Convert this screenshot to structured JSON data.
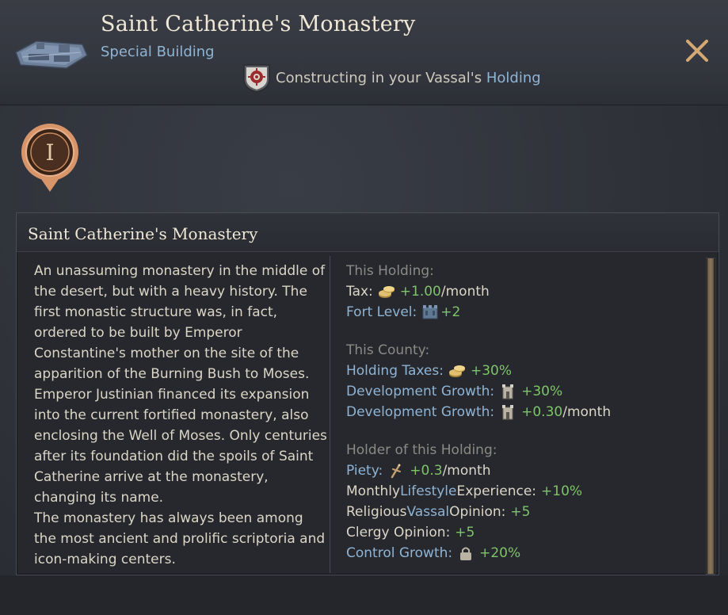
{
  "header": {
    "title": "Saint Catherine's Monastery",
    "subtitle": "Special Building",
    "constructing_prefix": "Constructing in your Vassal's ",
    "constructing_link": "Holding"
  },
  "level_badge": {
    "label": "I"
  },
  "panel": {
    "title": "Saint Catherine's Monastery",
    "description": [
      "An unassuming monastery in the middle of the desert, but with a heavy history. The first monastic structure was, in fact, ordered to be built by Emperor Constantine's mother on the site of the apparition of the Burning Bush to Moses. Emperor Justinian financed its expansion into the current fortified monastery, also enclosing the Well of Moses. Only centuries after its foundation did the spoils of Saint Catherine arrive at the monastery, changing its name.",
      "The monastery has always been among the most ancient and prolific scriptoria and icon-making centers."
    ],
    "effects": {
      "this_holding": {
        "heading": "This Holding:",
        "tax_label": "Tax:",
        "tax_value": "+1.00",
        "tax_unit": "/month",
        "fort_label": "Fort Level:",
        "fort_value": "+2"
      },
      "this_county": {
        "heading": "This County:",
        "holding_taxes_label": "Holding Taxes:",
        "holding_taxes_value": "+30%",
        "dev_label_1": "Development Growth:",
        "dev_value_1": "+30%",
        "dev_label_2": "Development Growth:",
        "dev_value_2": "+0.30",
        "dev_unit_2": "/month"
      },
      "holder": {
        "heading": "Holder of this Holding:",
        "piety_label": "Piety:",
        "piety_value": "+0.3",
        "piety_unit": "/month",
        "lifestyle_pre": "Monthly ",
        "lifestyle_link": "Lifestyle",
        "lifestyle_post": " Experience:",
        "lifestyle_value": "+10%",
        "vassal_pre": "Religious ",
        "vassal_link": "Vassal",
        "vassal_post": " Opinion:",
        "vassal_value": "+5",
        "clergy_label": "Clergy Opinion:",
        "clergy_value": "+5",
        "control_label": "Control Growth:",
        "control_value": "+20%"
      }
    }
  },
  "icons": {
    "building": "monastery-building-icon",
    "close": "close-icon",
    "shield": "vassal-shield-icon",
    "level": "level-badge-icon",
    "gold": "gold-coins-icon",
    "fort": "fort-icon",
    "development": "development-icon",
    "piety": "piety-icon",
    "control": "control-icon"
  },
  "colors": {
    "link_blue": "#8fb4d4",
    "positive_green": "#7fc46a",
    "heading_gray": "#8c8a84",
    "accent_orange": "#d8956a"
  }
}
